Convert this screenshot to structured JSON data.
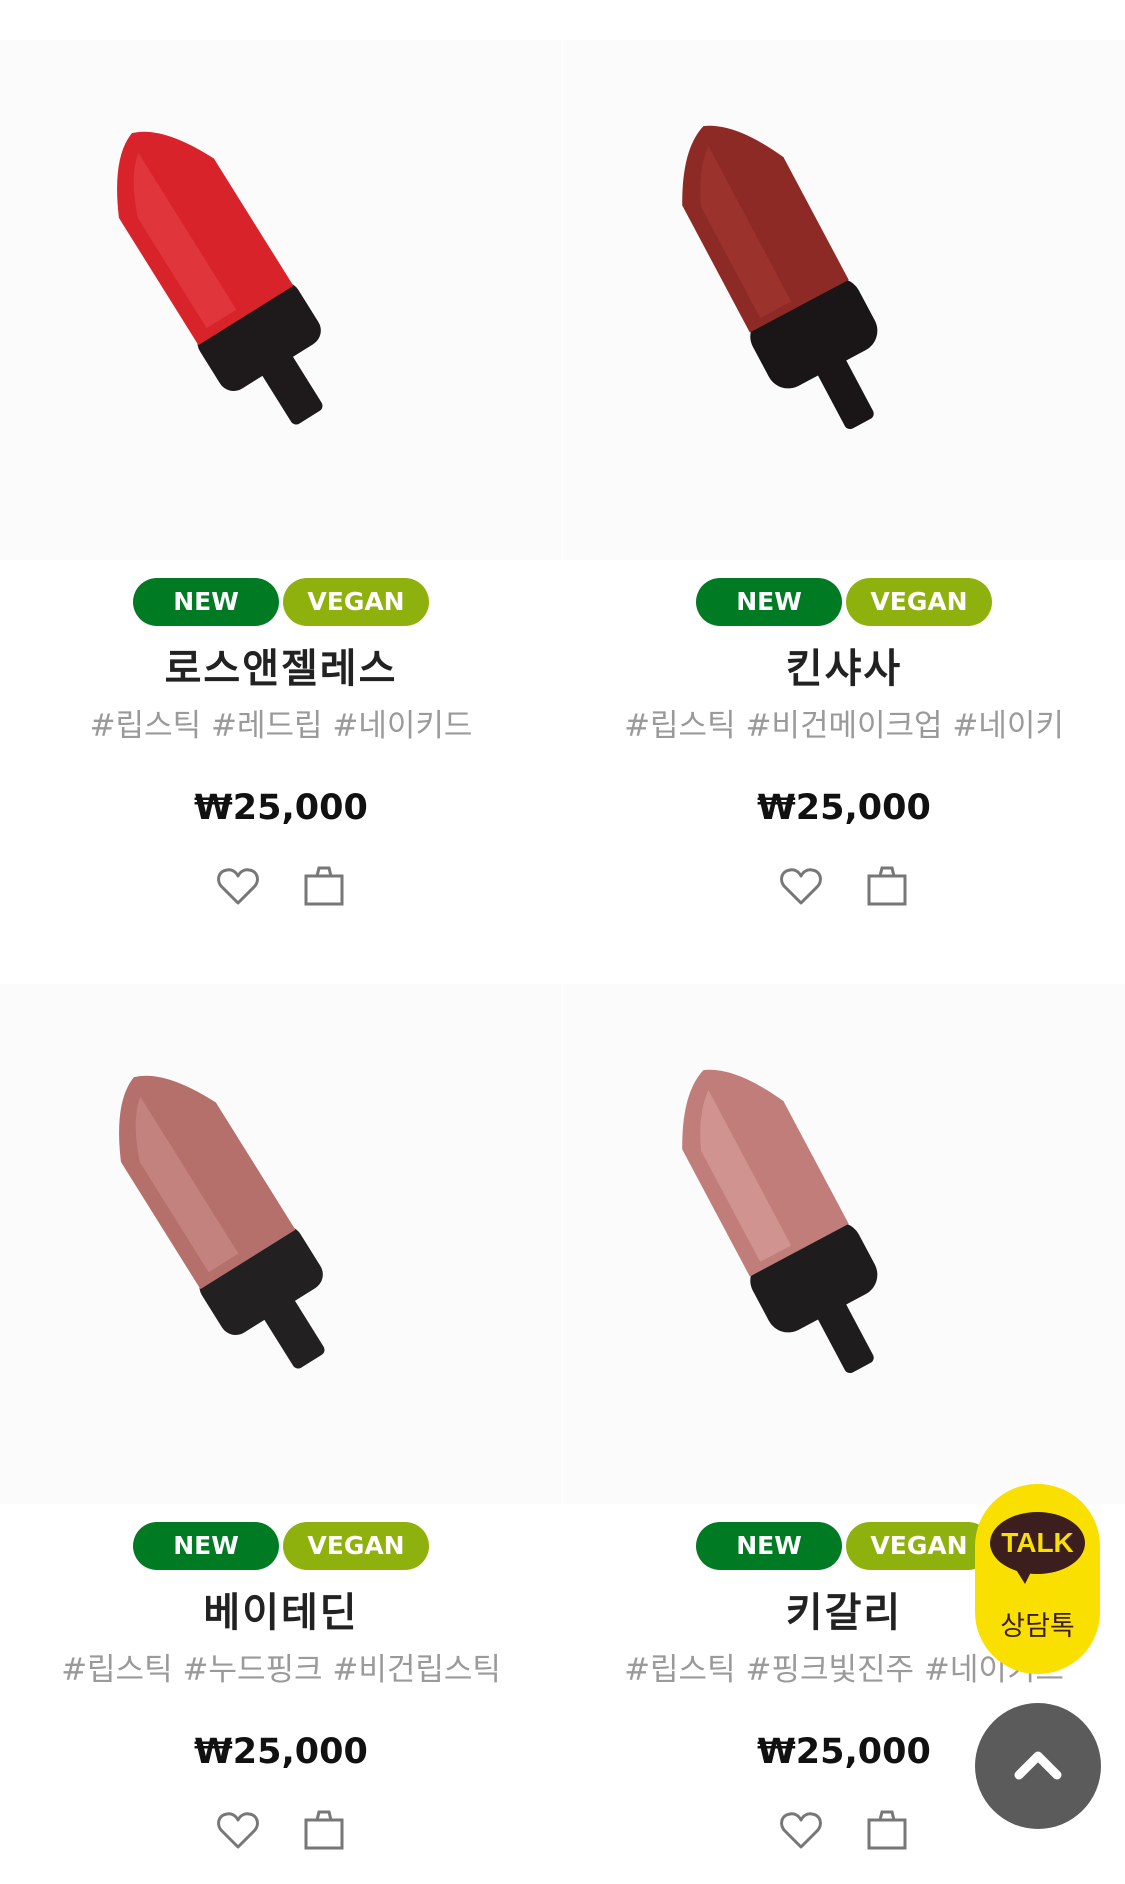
{
  "products": [
    {
      "badges": {
        "new": "NEW",
        "vegan": "VEGAN"
      },
      "name": "로스앤젤레스",
      "tags": "#립스틱 #레드립 #네이키드",
      "price": "₩25,000",
      "colors": {
        "tip": "#d8232a",
        "tip_light": "#f25a5a",
        "base": "#1e1a1c"
      }
    },
    {
      "badges": {
        "new": "NEW",
        "vegan": "VEGAN"
      },
      "name": "킨샤사",
      "tags": "#립스틱 #비건메이크업 #네이키",
      "price": "₩25,000",
      "colors": {
        "tip": "#8e2a25",
        "tip_light": "#b04038",
        "base": "#1a1517"
      }
    },
    {
      "badges": {
        "new": "NEW",
        "vegan": "VEGAN"
      },
      "name": "베이테딘",
      "tags": "#립스틱 #누드핑크 #비건립스틱",
      "price": "₩25,000",
      "colors": {
        "tip": "#b5706c",
        "tip_light": "#d59a94",
        "base": "#232022"
      }
    },
    {
      "badges": {
        "new": "NEW",
        "vegan": "VEGAN"
      },
      "name": "키갈리",
      "tags": "#립스틱 #핑크빛진주 #네이키드",
      "price": "₩25,000",
      "colors": {
        "tip": "#c07d7a",
        "tip_light": "#e1aaa6",
        "base": "#1f1c1e"
      }
    }
  ],
  "kakao_talk": {
    "logo": "TALK",
    "label": "상담톡"
  },
  "icons": {
    "wishlist": "heart-icon",
    "cart": "shopping-bag-icon",
    "top": "chevron-up-icon"
  },
  "colors": {
    "new_badge": "#007a23",
    "vegan_badge": "#8fb10e",
    "kakao": "#f9e000"
  }
}
